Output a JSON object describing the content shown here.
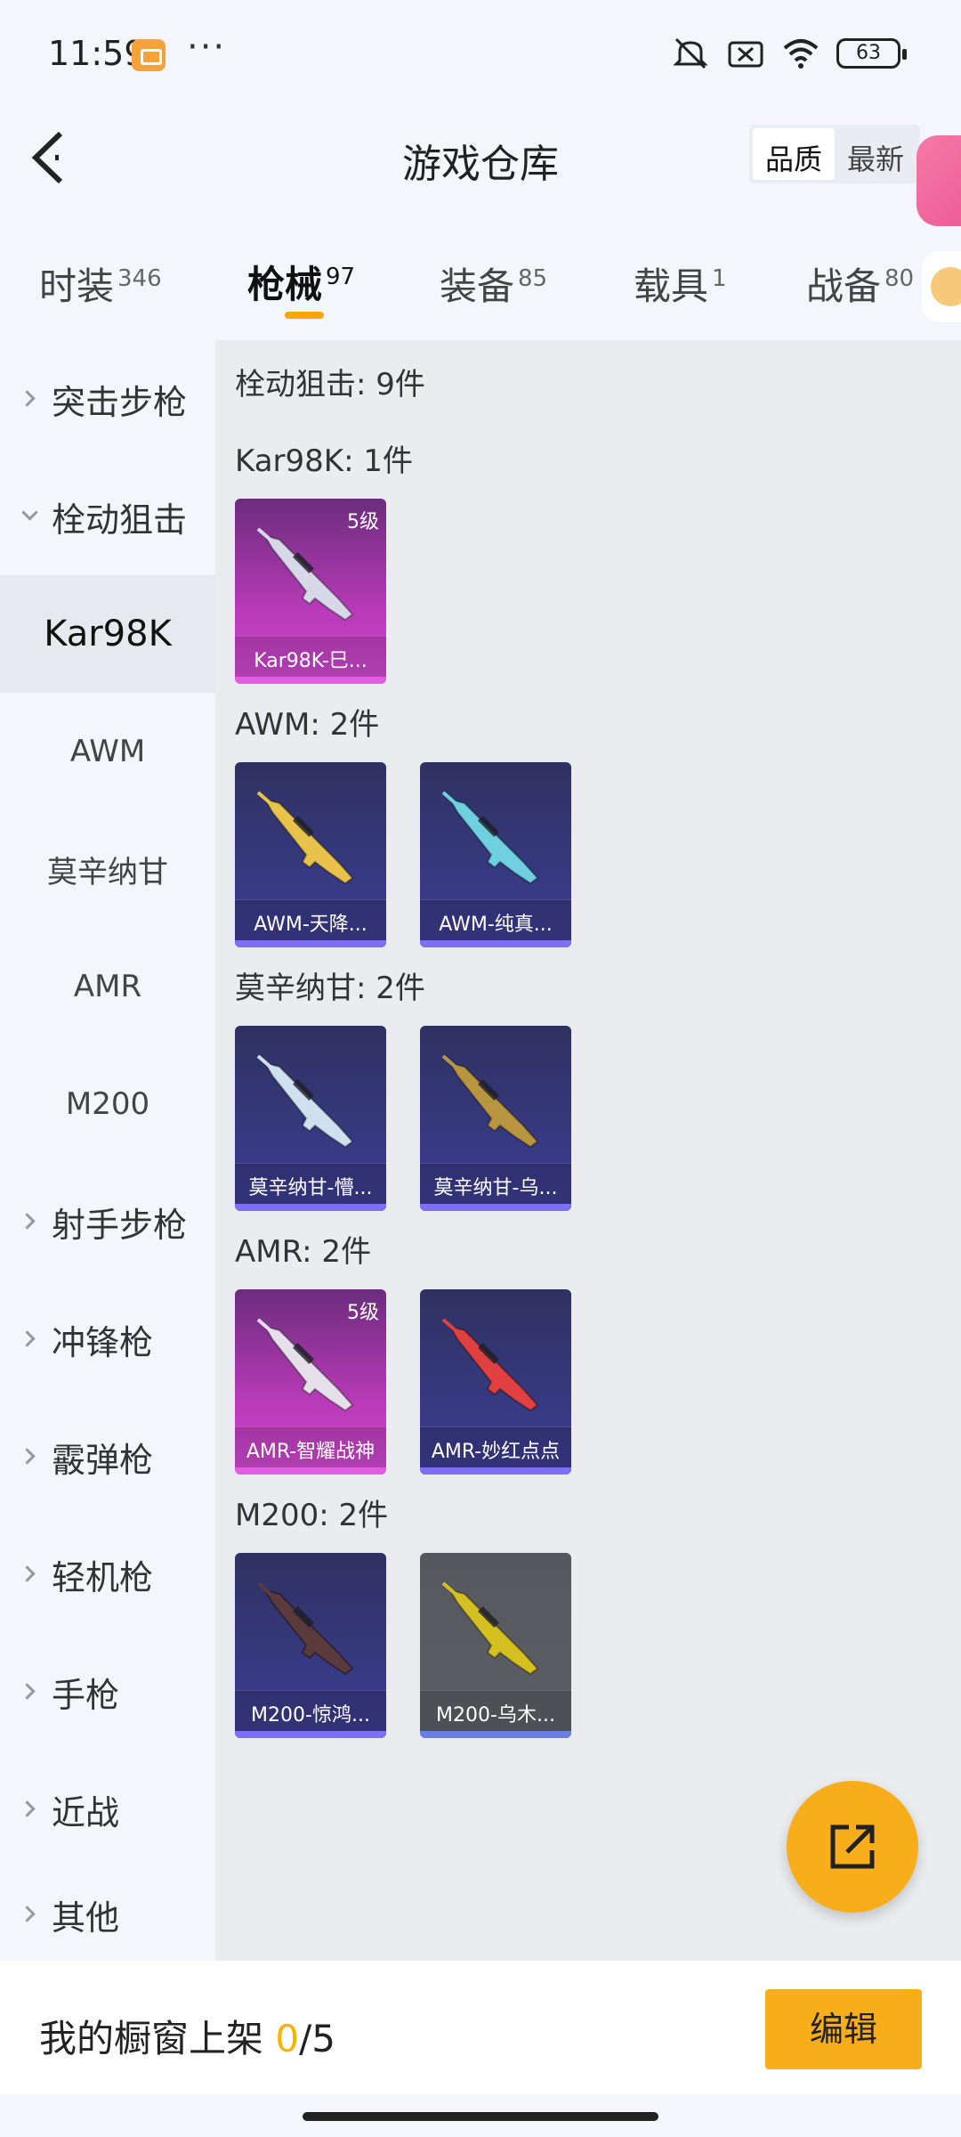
{
  "status": {
    "time": "11:59",
    "dots": "···",
    "battery": "63"
  },
  "header": {
    "title": "游戏仓库",
    "sort_options": [
      "品质",
      "最新"
    ]
  },
  "tabs": [
    {
      "label": "时装",
      "count": "346"
    },
    {
      "label": "枪械",
      "count": "97"
    },
    {
      "label": "装备",
      "count": "85"
    },
    {
      "label": "载具",
      "count": "1"
    },
    {
      "label": "战备",
      "count": "80"
    }
  ],
  "sidebar": {
    "items": [
      {
        "label": "突击步枪"
      },
      {
        "label": "栓动狙击"
      },
      {
        "label": "Kar98K"
      },
      {
        "label": "AWM"
      },
      {
        "label": "莫辛纳甘"
      },
      {
        "label": "AMR"
      },
      {
        "label": "M200"
      },
      {
        "label": "射手步枪"
      },
      {
        "label": "冲锋枪"
      },
      {
        "label": "霰弹枪"
      },
      {
        "label": "轻机枪"
      },
      {
        "label": "手枪"
      },
      {
        "label": "近战"
      },
      {
        "label": "其他"
      }
    ]
  },
  "content": {
    "category_title": "栓动狙击: 9件",
    "sections": [
      {
        "title": "Kar98K: 1件",
        "items": [
          {
            "name": "Kar98K-巳...",
            "level": "5级",
            "quality": "pink",
            "gun_color": "#d8d8e8"
          }
        ]
      },
      {
        "title": "AWM: 2件",
        "items": [
          {
            "name": "AWM-天降...",
            "level": "",
            "quality": "blue",
            "gun_color": "#e8c24a"
          },
          {
            "name": "AWM-纯真...",
            "level": "",
            "quality": "blue",
            "gun_color": "#6fd0e0"
          }
        ]
      },
      {
        "title": "莫辛纳甘: 2件",
        "items": [
          {
            "name": "莫辛纳甘-懵...",
            "level": "",
            "quality": "blue",
            "gun_color": "#cfe0ee"
          },
          {
            "name": "莫辛纳甘-乌...",
            "level": "",
            "quality": "blue",
            "gun_color": "#b89540"
          }
        ]
      },
      {
        "title": "AMR: 2件",
        "items": [
          {
            "name": "AMR-智耀战神",
            "level": "5级",
            "quality": "pink",
            "gun_color": "#e6e0ea"
          },
          {
            "name": "AMR-妙红点点",
            "level": "",
            "quality": "blue",
            "gun_color": "#e04040"
          }
        ]
      },
      {
        "title": "M200: 2件",
        "items": [
          {
            "name": "M200-惊鸿...",
            "level": "",
            "quality": "blue",
            "gun_color": "#5a3a3a"
          },
          {
            "name": "M200-乌木...",
            "level": "",
            "quality": "gray",
            "gun_color": "#d4c020"
          }
        ]
      }
    ]
  },
  "bottom": {
    "showcase_label": "我的橱窗上架",
    "showcase_current": "0",
    "showcase_total": "/5",
    "edit_label": "编辑"
  },
  "colors": {
    "accent": "#f8ae1a",
    "pink_quality": "#d24ad0",
    "blue_quality": "#3c3b8e"
  }
}
